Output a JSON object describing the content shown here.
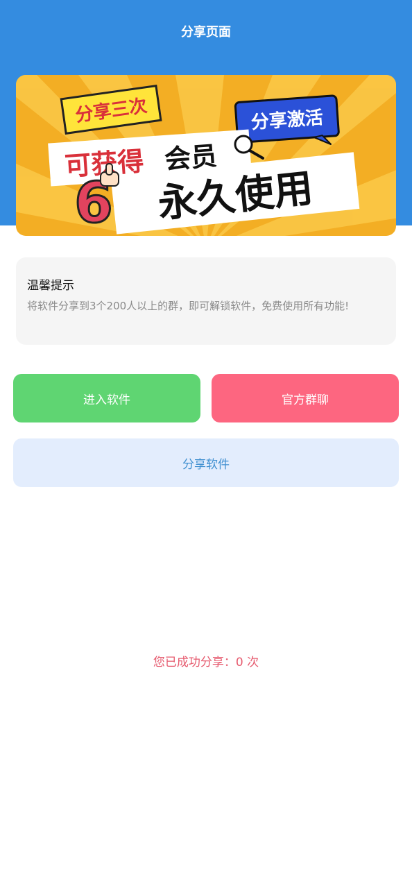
{
  "header": {
    "title": "分享页面",
    "background_color": "#348ce0"
  },
  "banner": {
    "tag_left": "分享三次",
    "tag_right": "分享激活",
    "line_red": "可获得",
    "line_black": "会员",
    "line_big": "永久使用",
    "number": "6",
    "colors": {
      "yellow": "#f7b82a",
      "red": "#d9303a",
      "blue": "#2b51d8"
    }
  },
  "tip": {
    "title": "温馨提示",
    "body": "将软件分享到3个200人以上的群，即可解锁软件，免费使用所有功能!"
  },
  "buttons": {
    "enter": "进入软件",
    "group": "官方群聊",
    "share": "分享软件"
  },
  "status": {
    "share_count_text": "您已成功分享：0 次"
  }
}
